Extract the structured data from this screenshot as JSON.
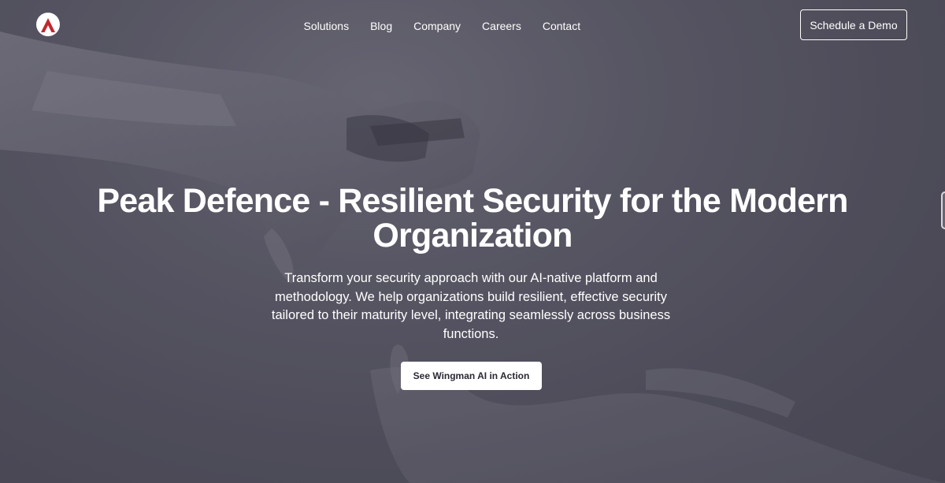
{
  "brand": {
    "logo_icon": "mountain-peak-icon",
    "logo_colors": {
      "circle": "#ffffff",
      "peak": "#c0272d"
    }
  },
  "nav": {
    "items": [
      {
        "label": "Solutions"
      },
      {
        "label": "Blog"
      },
      {
        "label": "Company"
      },
      {
        "label": "Careers"
      },
      {
        "label": "Contact"
      }
    ],
    "demo_button": "Schedule a Demo"
  },
  "hero": {
    "headline_line1": "Peak Defence - Resilient Security for the Modern",
    "headline_line2": "Organization",
    "subtext": "Transform your security approach with our AI-native platform and methodology. We help organizations build resilient, effective security tailored to their maturity level, integrating seamlessly across business functions.",
    "cta": "See Wingman AI in Action",
    "background_image": "robot-hand-reaching-human-hand"
  },
  "colors": {
    "background": "#5a5866",
    "text": "#ffffff",
    "cta_text": "#2a2833"
  }
}
